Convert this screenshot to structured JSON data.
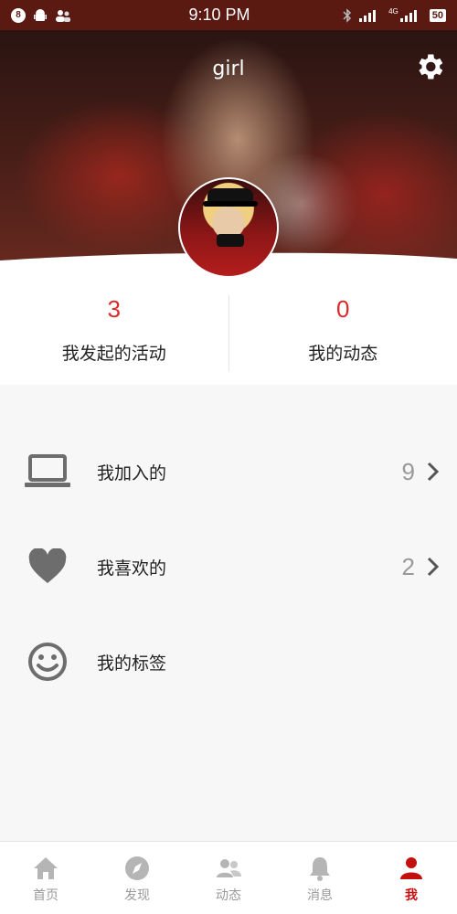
{
  "status_bar": {
    "notification_count": "8",
    "time": "9:10 PM",
    "network": "4G",
    "battery": "50"
  },
  "header": {
    "title": "girl",
    "settings_icon": "gear-icon"
  },
  "stats": [
    {
      "value": "3",
      "label": "我发起的活动"
    },
    {
      "value": "0",
      "label": "我的动态"
    }
  ],
  "menu": [
    {
      "icon": "laptop-icon",
      "label": "我加入的",
      "count": "9"
    },
    {
      "icon": "heart-icon",
      "label": "我喜欢的",
      "count": "2"
    },
    {
      "icon": "smiley-icon",
      "label": "我的标签",
      "count": ""
    }
  ],
  "tabs": [
    {
      "icon": "home-icon",
      "label": "首页",
      "active": false
    },
    {
      "icon": "compass-icon",
      "label": "发现",
      "active": false
    },
    {
      "icon": "people-icon",
      "label": "动态",
      "active": false
    },
    {
      "icon": "bell-icon",
      "label": "消息",
      "active": false
    },
    {
      "icon": "person-icon",
      "label": "我",
      "active": true
    }
  ],
  "colors": {
    "accent": "#d92b2b",
    "active_tab": "#c40f0f",
    "inactive": "#9a9a9a",
    "status_bar": "#5a1a12"
  }
}
